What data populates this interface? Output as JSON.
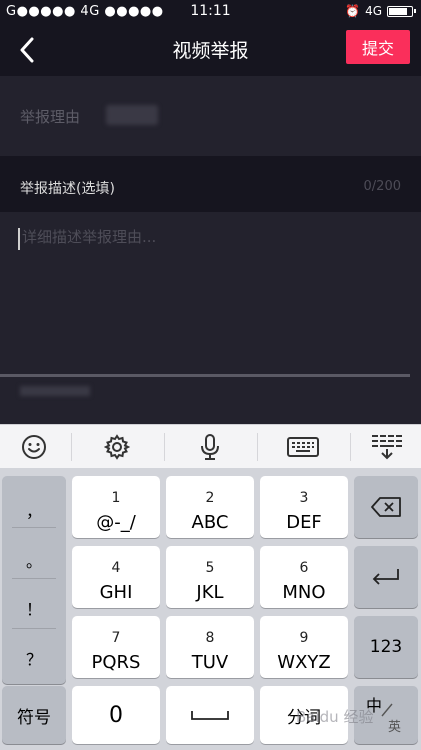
{
  "status_bar": {
    "carrier_left": "G●●●●● 4G ●●●●●",
    "time": "11:11",
    "network_right": "4G",
    "battery_level": 0.85
  },
  "header": {
    "title": "视频举报",
    "submit_label": "提交",
    "back_icon": "chevron-left-icon"
  },
  "form": {
    "reason_label": "举报理由",
    "description_label": "举报描述(选填)",
    "description_count": "0/200",
    "description_placeholder": "详细描述举报理由..."
  },
  "keyboard_toolbar": {
    "icons": [
      "smiley-icon",
      "gear-icon",
      "microphone-icon",
      "keyboard-icon",
      "collapse-keyboard-icon"
    ]
  },
  "keyboard": {
    "punctuation": [
      "，",
      "。",
      "！",
      "？"
    ],
    "keys": [
      {
        "num": "1",
        "letters": "@-_/"
      },
      {
        "num": "2",
        "letters": "ABC"
      },
      {
        "num": "3",
        "letters": "DEF"
      },
      {
        "num": "4",
        "letters": "GHI"
      },
      {
        "num": "5",
        "letters": "JKL"
      },
      {
        "num": "6",
        "letters": "MNO"
      },
      {
        "num": "7",
        "letters": "PQRS"
      },
      {
        "num": "8",
        "letters": "TUV"
      },
      {
        "num": "9",
        "letters": "WXYZ"
      }
    ],
    "delete_icon": "backspace-icon",
    "return_icon": "return-icon",
    "num_switch_label": "123",
    "symbols_label": "符号",
    "zero_label": "0",
    "space_icon": "space-bar-icon",
    "segment_label": "分词",
    "lang_label": "中",
    "lang_sub_label": "英"
  },
  "watermark": "Baidu 经验"
}
